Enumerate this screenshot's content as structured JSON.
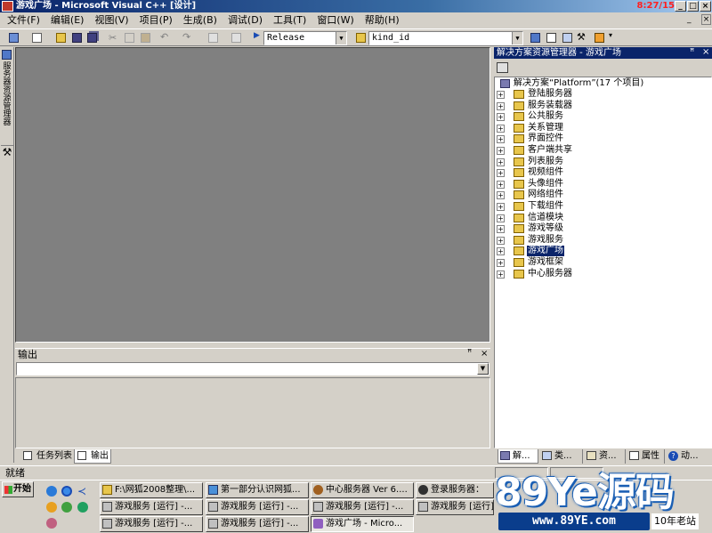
{
  "window": {
    "title": "游戏广场 - Microsoft Visual C++ [设计]",
    "clock": "8:27/15:"
  },
  "menu": [
    "文件(F)",
    "编辑(E)",
    "视图(V)",
    "项目(P)",
    "生成(B)",
    "调试(D)",
    "工具(T)",
    "窗口(W)",
    "帮助(H)"
  ],
  "toolbar": {
    "configuration": "Release",
    "find_value": "kind_id"
  },
  "left_tabs": {
    "server_explorer": "服务器资源管理器"
  },
  "output": {
    "title": "输出",
    "tabs": [
      "任务列表",
      "输出"
    ]
  },
  "solution_explorer": {
    "title": "解决方案资源管理器 - 游戏广场",
    "root": "解决方案“Platform”(17 个项目)",
    "projects": [
      "登陆服务器",
      "服务装载器",
      "公共服务",
      "关系管理",
      "界面控件",
      "客户端共享",
      "列表服务",
      "视频组件",
      "头像组件",
      "网络组件",
      "下载组件",
      "信道模块",
      "游戏等级",
      "游戏服务",
      "游戏广场",
      "游戏框架",
      "中心服务器"
    ],
    "selected": "游戏广场",
    "tabs": [
      "解...",
      "类...",
      "资...",
      "属性",
      "动..."
    ]
  },
  "status": {
    "text": "就绪"
  },
  "taskbar": {
    "start": "开始",
    "tasks": [
      {
        "label": "F:\\网狐2008整理\\...",
        "active": false
      },
      {
        "label": "第一部分认识网狐...",
        "active": false
      },
      {
        "label": "中心服务器 Ver 6....",
        "active": false
      },
      {
        "label": "登录服务器：",
        "active": false
      },
      {
        "label": "游戏服务 [运行] -...",
        "active": false
      },
      {
        "label": "游戏服务 [运行] -...",
        "active": false
      },
      {
        "label": "游戏服务 [运行] -...",
        "active": false
      },
      {
        "label": "游戏服务 [运行]",
        "active": false
      },
      {
        "label": "游戏服务 [运行] -...",
        "active": false
      },
      {
        "label": "游戏服务 [运行] -...",
        "active": false
      },
      {
        "label": "游戏广场 - Micro...",
        "active": true
      }
    ]
  },
  "watermark": {
    "brand": "89Ye源码",
    "url": "www.89YE.com",
    "tagline": "10年老站"
  }
}
